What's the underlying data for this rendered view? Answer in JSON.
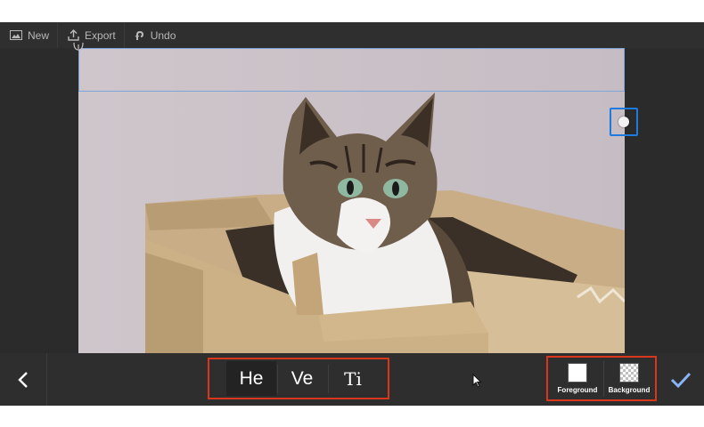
{
  "toolbar": {
    "new_label": "New",
    "export_label": "Export",
    "undo_label": "Undo"
  },
  "icons": {
    "new": "image-icon",
    "export": "upload-icon",
    "undo": "undo-icon",
    "back": "chevron-left-icon",
    "confirm": "checkmark-icon",
    "rotate": "rotate-handle-icon"
  },
  "modes": [
    {
      "label": "He",
      "active": true
    },
    {
      "label": "Ve",
      "active": false
    },
    {
      "label": "Ti",
      "active": false
    }
  ],
  "colors": {
    "foreground_label": "Foreground",
    "background_label": "Background",
    "foreground_value": "#ffffff",
    "background_value": "transparent"
  },
  "theme": {
    "accent": "#1f7ae0",
    "confirm": "#8ab4f8",
    "highlight": "#d9371c"
  }
}
